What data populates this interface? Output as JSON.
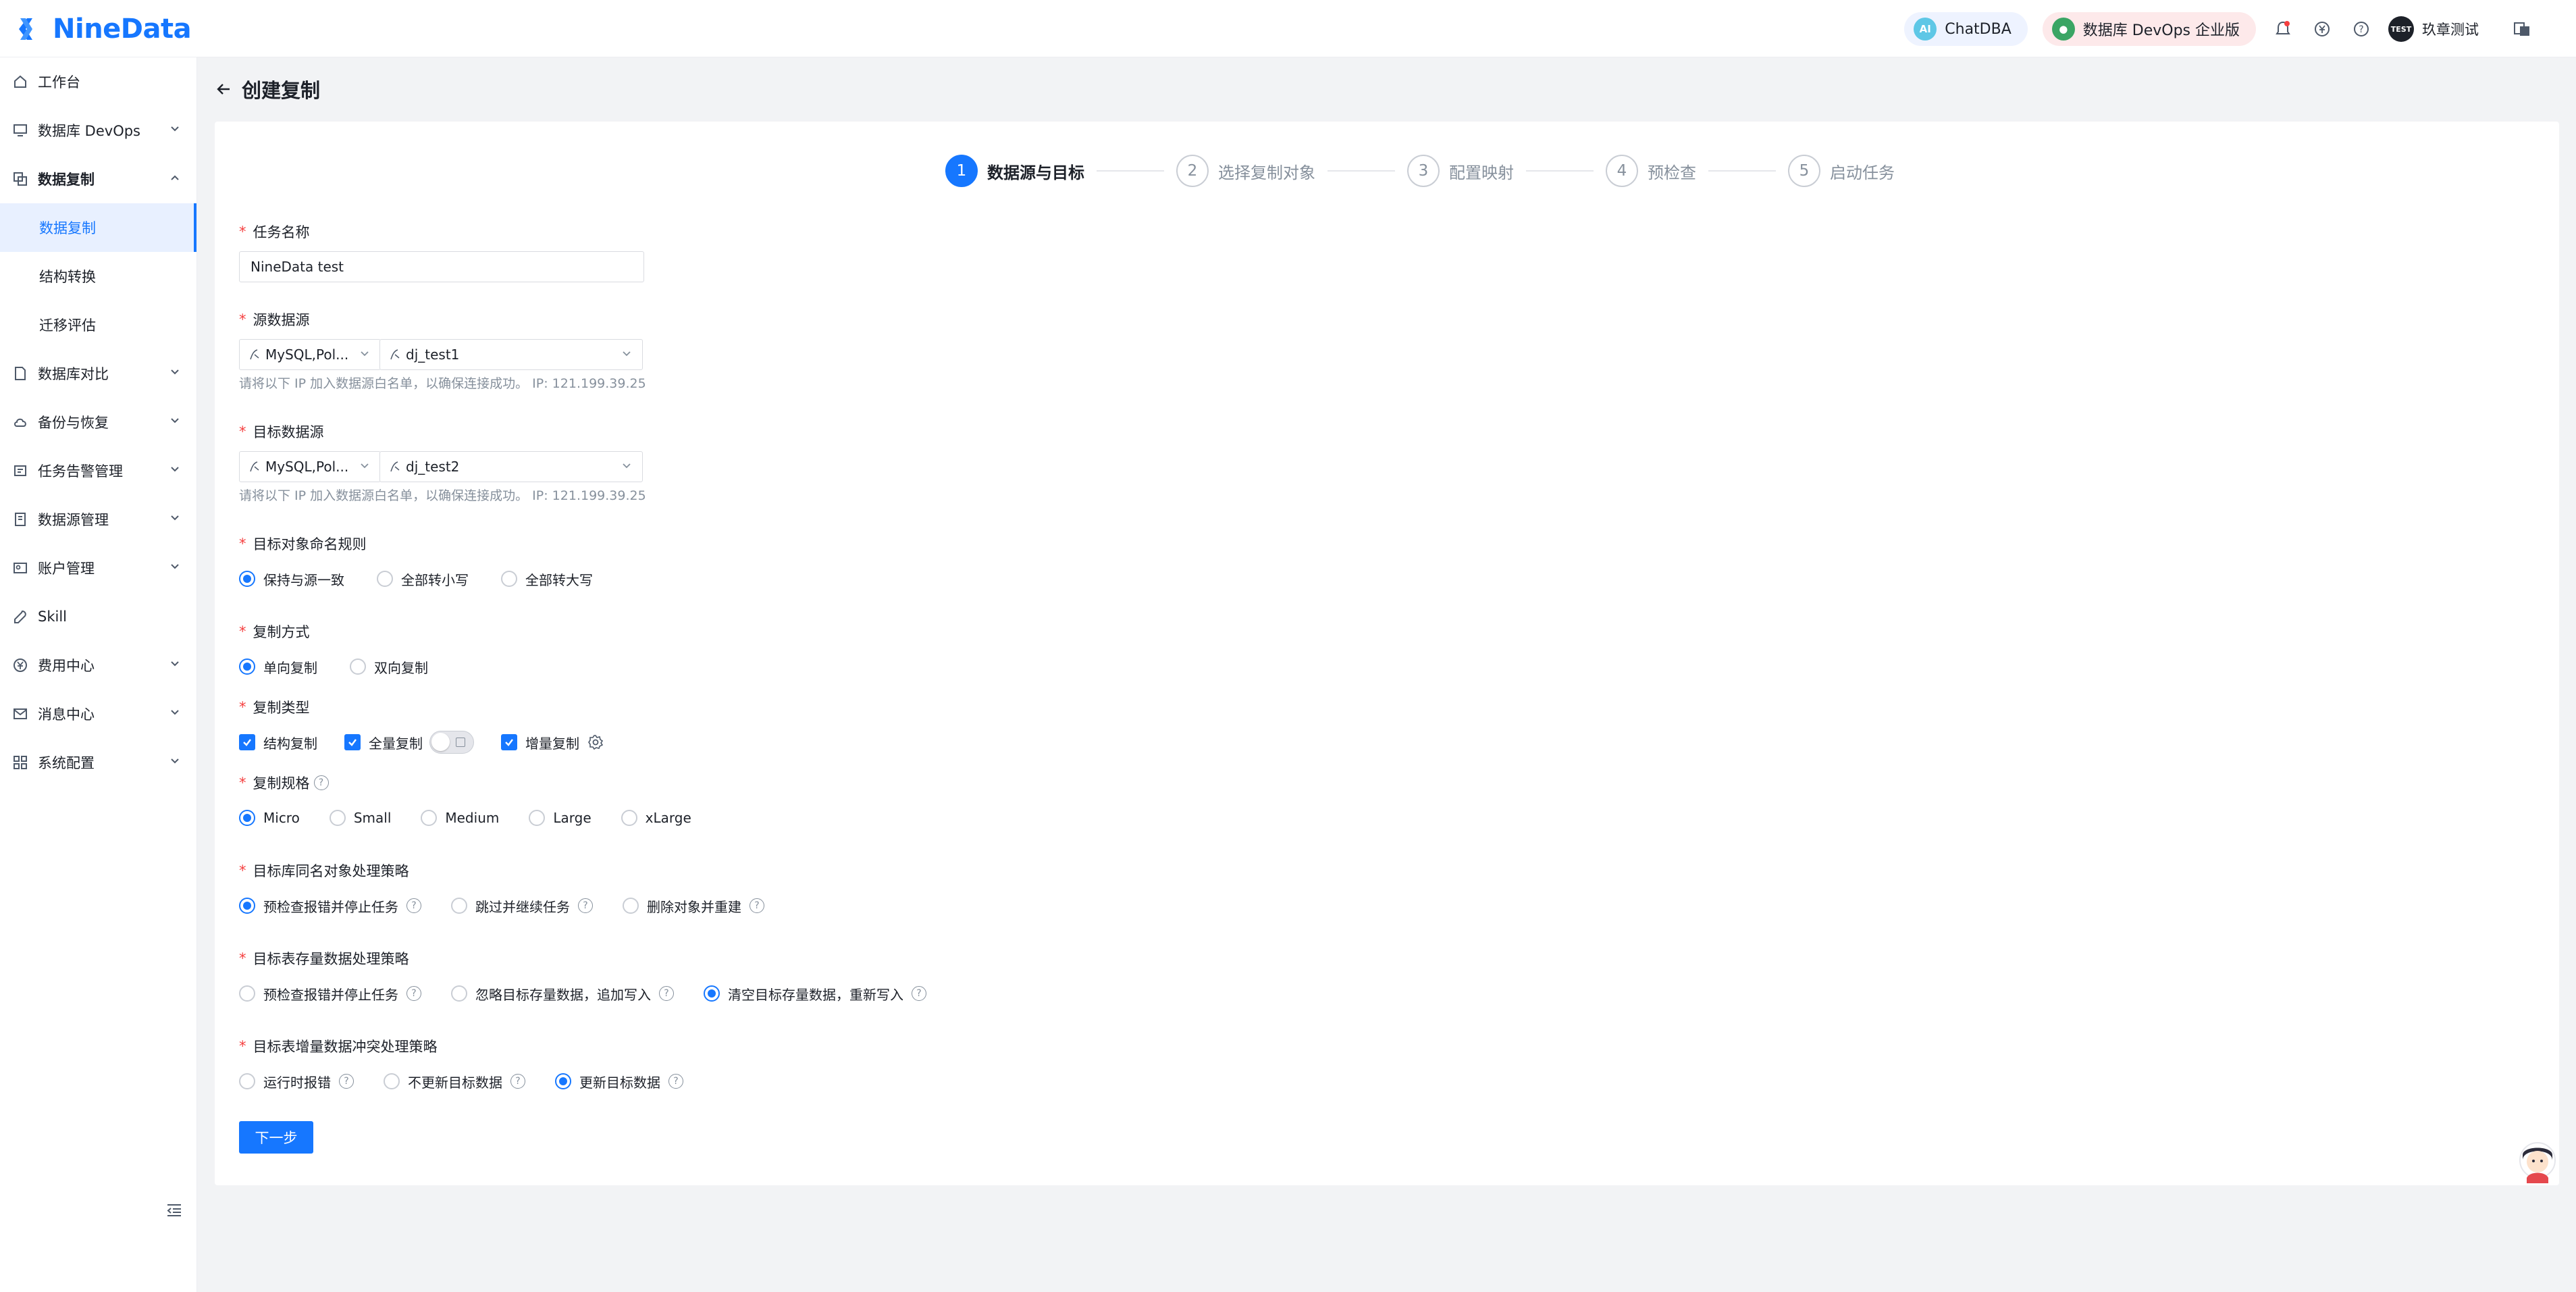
{
  "brand": {
    "name": "NineData",
    "color": "#1677ff"
  },
  "header": {
    "chatdba_label": "ChatDBA",
    "devops_label": "数据库 DevOps 企业版",
    "avatar_text": "TEST",
    "user_name": "玖章测试"
  },
  "sidebar": {
    "items": [
      {
        "label": "工作台",
        "icon": "home-icon"
      },
      {
        "label": "数据库 DevOps",
        "icon": "monitor-icon"
      },
      {
        "label": "数据复制",
        "icon": "copy-icon",
        "expanded": true
      },
      {
        "label": "数据库对比",
        "icon": "document-icon"
      },
      {
        "label": "备份与恢复",
        "icon": "cloud-icon"
      },
      {
        "label": "任务告警管理",
        "icon": "alarm-icon"
      },
      {
        "label": "数据源管理",
        "icon": "datasource-icon"
      },
      {
        "label": "账户管理",
        "icon": "user-card-icon"
      },
      {
        "label": "Skill",
        "icon": "wrench-icon"
      },
      {
        "label": "费用中心",
        "icon": "yen-icon"
      },
      {
        "label": "消息中心",
        "icon": "mail-icon"
      },
      {
        "label": "系统配置",
        "icon": "grid-icon"
      }
    ],
    "sub_items": [
      "数据复制",
      "结构转换",
      "迁移评估"
    ]
  },
  "page": {
    "title": "创建复制"
  },
  "steps": [
    {
      "num": "1",
      "label": "数据源与目标"
    },
    {
      "num": "2",
      "label": "选择复制对象"
    },
    {
      "num": "3",
      "label": "配置映射"
    },
    {
      "num": "4",
      "label": "预检查"
    },
    {
      "num": "5",
      "label": "启动任务"
    }
  ],
  "form": {
    "task_name": {
      "label": "任务名称",
      "value": "NineData test"
    },
    "source": {
      "label": "源数据源",
      "type": "MySQL,Pol...",
      "value": "dj_test1",
      "hint": "请将以下 IP 加入数据源白名单，以确保连接成功。 IP: 121.199.39.25"
    },
    "target": {
      "label": "目标数据源",
      "type": "MySQL,Pol...",
      "value": "dj_test2",
      "hint": "请将以下 IP 加入数据源白名单，以确保连接成功。 IP: 121.199.39.25"
    },
    "naming_rule": {
      "label": "目标对象命名规则",
      "options": [
        "保持与源一致",
        "全部转小写",
        "全部转大写"
      ],
      "selected": 0
    },
    "copy_mode": {
      "label": "复制方式",
      "options": [
        "单向复制",
        "双向复制"
      ],
      "selected": 0
    },
    "copy_type": {
      "label": "复制类型",
      "options": [
        "结构复制",
        "全量复制",
        "增量复制"
      ]
    },
    "spec": {
      "label": "复制规格",
      "options": [
        "Micro",
        "Small",
        "Medium",
        "Large",
        "xLarge"
      ],
      "selected": 0
    },
    "same_name_policy": {
      "label": "目标库同名对象处理策略",
      "options": [
        "预检查报错并停止任务",
        "跳过并继续任务",
        "删除对象并重建"
      ],
      "selected": 0
    },
    "existing_data_policy": {
      "label": "目标表存量数据处理策略",
      "options": [
        "预检查报错并停止任务",
        "忽略目标存量数据，追加写入",
        "清空目标存量数据，重新写入"
      ],
      "selected": 2
    },
    "conflict_policy": {
      "label": "目标表增量数据冲突处理策略",
      "options": [
        "运行时报错",
        "不更新目标数据",
        "更新目标数据"
      ],
      "selected": 2
    }
  },
  "next_button": "下一步"
}
